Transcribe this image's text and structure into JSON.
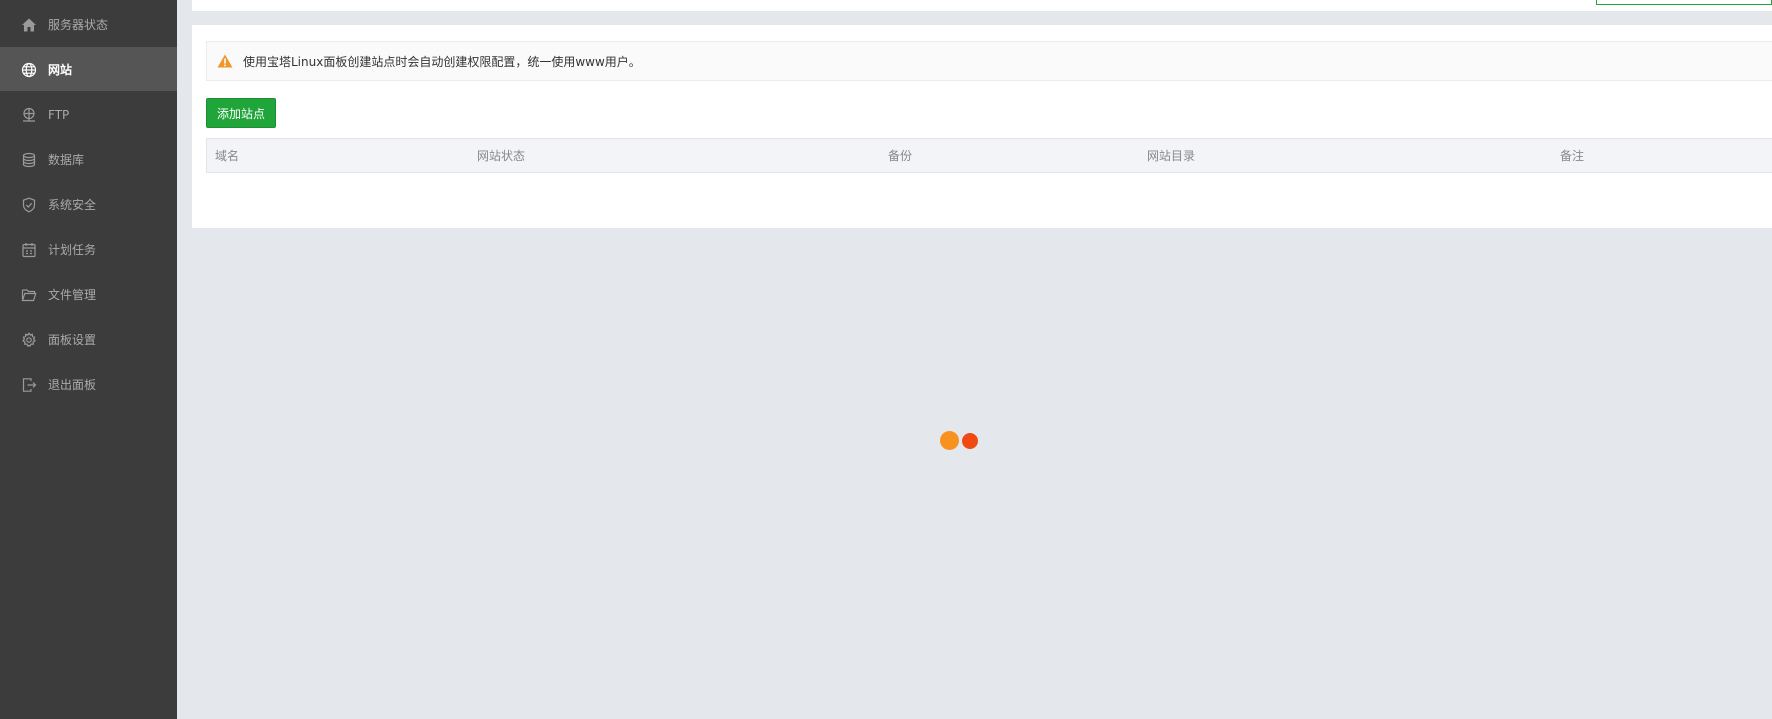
{
  "sidebar": {
    "items": [
      {
        "label": "服务器状态",
        "icon": "home-icon",
        "active": false
      },
      {
        "label": "网站",
        "icon": "globe-icon",
        "active": true
      },
      {
        "label": "FTP",
        "icon": "ftp-icon",
        "active": false
      },
      {
        "label": "数据库",
        "icon": "database-icon",
        "active": false
      },
      {
        "label": "系统安全",
        "icon": "shield-icon",
        "active": false
      },
      {
        "label": "计划任务",
        "icon": "calendar-icon",
        "active": false
      },
      {
        "label": "文件管理",
        "icon": "folder-icon",
        "active": false
      },
      {
        "label": "面板设置",
        "icon": "gear-icon",
        "active": false
      },
      {
        "label": "退出面板",
        "icon": "logout-icon",
        "active": false
      }
    ]
  },
  "main": {
    "alert_text": "使用宝塔Linux面板创建站点时会自动创建权限配置，统一使用www用户。",
    "add_site_label": "添加站点",
    "table": {
      "columns": [
        "域名",
        "网站状态",
        "备份",
        "网站目录",
        "备注"
      ],
      "rows": []
    }
  },
  "colors": {
    "accent": "#20a53a",
    "sidebar_bg": "#3c3c3c",
    "sidebar_active": "#555555",
    "warning": "#f0962a",
    "loader_orange": "#f7921e",
    "loader_red": "#f04a12"
  }
}
